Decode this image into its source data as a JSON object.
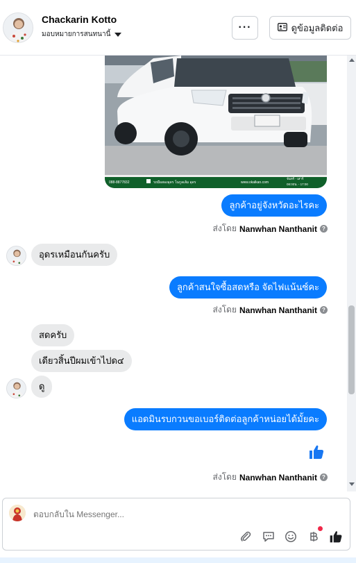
{
  "header": {
    "contact_name": "Chackarin Kotto",
    "assign_label": "มอบหมายการสนทนานี้",
    "more_label": "···",
    "contact_info_label": "ดูข้อมูลติดต่อ"
  },
  "messages": {
    "out_1": "ลูกค้าอยู่จังหวัดอะไรคะ",
    "in_1": "อุดรเหมือนกันครับ",
    "out_2": "ลูกค้าสนใจซื้อสดหรือ จัดไฟแน้นซ์คะ",
    "in_2": "สดครับ",
    "in_3": "เดียวสิ้นปีผมเข้าไปด๔",
    "in_4": "ดู",
    "out_3": "แอดมินรบกวนขอเบอร์ติดต่อลูกค้าหน่อยได้มั้ยคะ"
  },
  "sent_by": {
    "prefix": "ส่งโดย",
    "name": "Nanwhan Nanthanit",
    "help": "?"
  },
  "image_caption": {
    "phone": "088-8877832",
    "page": "รถมือสองอุดร โนกูลเล้ม อุดร",
    "site": "www.okalkan.com",
    "days": "จันทร์ - เสาร์",
    "hours": "08:00น. - 17:00"
  },
  "composer": {
    "placeholder": "ตอบกลับใน Messenger..."
  },
  "icons": {
    "attach": "paperclip-icon",
    "saved_reply": "chat-bubble-icon",
    "emoji": "smiley-icon",
    "payment": "baht-icon",
    "like": "thumbs-up-icon"
  },
  "colors": {
    "outgoing": "#0a7cff",
    "incoming": "#e9eaeb",
    "like": "#1877f2",
    "notification_dot": "#f02849"
  }
}
